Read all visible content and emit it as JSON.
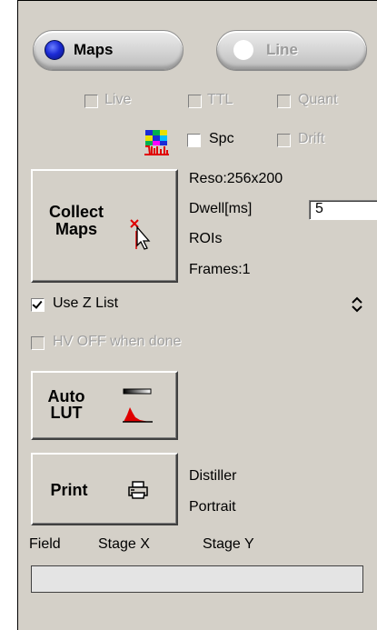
{
  "mode_buttons": {
    "maps": {
      "label": "Maps",
      "selected": true
    },
    "line": {
      "label": "Line",
      "selected": false
    }
  },
  "options_row1": [
    {
      "label": "Live",
      "checked": false,
      "enabled": false
    },
    {
      "label": "TTL",
      "checked": false,
      "enabled": false
    },
    {
      "label": "Quant",
      "checked": false,
      "enabled": false
    }
  ],
  "options_row2": {
    "spc": {
      "label": "Spc",
      "checked": false,
      "enabled": true
    },
    "drift": {
      "label": "Drift",
      "checked": false,
      "enabled": false
    },
    "icon": "spectrum-map-icon"
  },
  "collect": {
    "label_line1": "Collect",
    "label_line2": "Maps",
    "icon": "cursor-target-icon",
    "reso": "Reso:256x200",
    "dwell_label": "Dwell[ms]",
    "dwell_value": "5",
    "rois": "ROIs",
    "frames": "Frames:1"
  },
  "use_z_list": {
    "label": "Use Z List",
    "checked": true,
    "enabled": true
  },
  "sort_icon": "up-down-chevron-icon",
  "hv_off": {
    "label": "HV OFF when done",
    "checked": false,
    "enabled": false
  },
  "auto_lut": {
    "label_line1": "Auto",
    "label_line2": "LUT",
    "icon": "histogram-lut-icon"
  },
  "print": {
    "label": "Print",
    "icon": "printer-icon",
    "printer": "Distiller",
    "orientation": "Portrait"
  },
  "coords": {
    "field": "Field",
    "stage_x": "Stage X",
    "stage_y": "Stage Y"
  },
  "colors": {
    "panel": "#d4d0c8",
    "radio_on": "#1b2bd6",
    "lut_red": "#e00000"
  }
}
